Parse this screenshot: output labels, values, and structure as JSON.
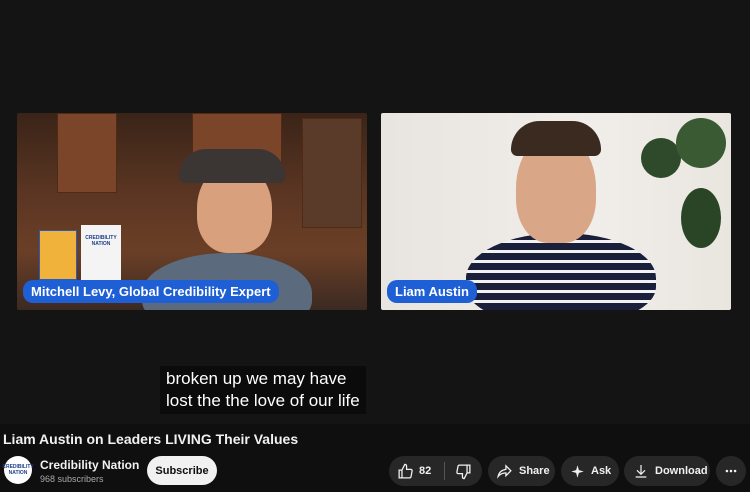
{
  "video": {
    "left_name_tag": "Mitchell Levy, Global Credibility Expert",
    "right_name_tag": "Liam Austin",
    "book_title": "CREDIBILITY NATION",
    "caption_lines": [
      "broken up we may have",
      "lost the the love of our life"
    ]
  },
  "title": "Liam Austin on Leaders LIVING Their Values",
  "channel": {
    "avatar_text": "CREDIBILITY NATION",
    "name": "Credibility Nation",
    "subscribers": "968 subscribers",
    "subscribe_label": "Subscribe"
  },
  "actions": {
    "like_count": "82",
    "share_label": "Share",
    "ask_label": "Ask",
    "download_label": "Download"
  },
  "icons": [
    "thumbs-up-icon",
    "thumbs-down-icon",
    "share-icon",
    "sparkle-icon",
    "download-icon",
    "more-icon"
  ]
}
